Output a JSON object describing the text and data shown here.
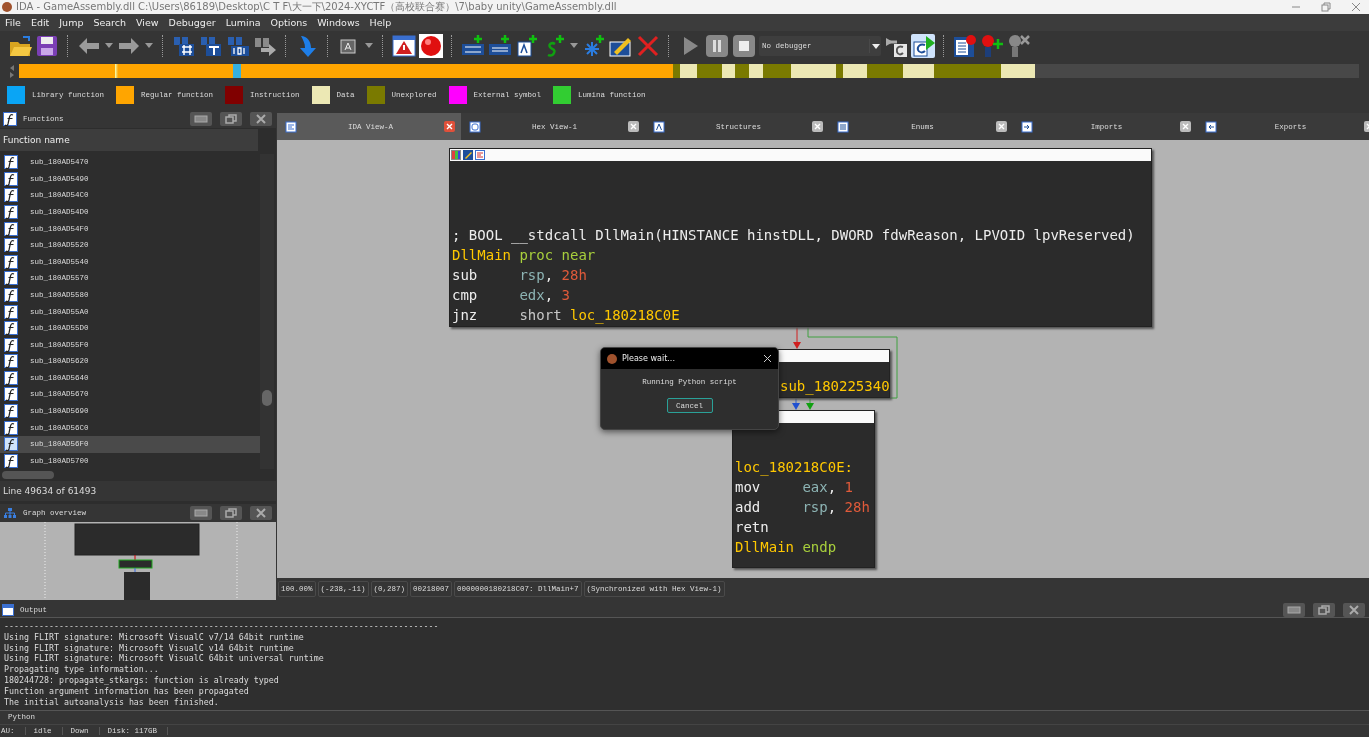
{
  "window": {
    "title": "IDA - GameAssembly.dll C:\\Users\\86189\\Desktop\\C T F\\大一下\\2024-XYCTF（高校联合赛）\\7\\baby unity\\GameAssembly.dll"
  },
  "menu": [
    "File",
    "Edit",
    "Jump",
    "Search",
    "View",
    "Debugger",
    "Lumina",
    "Options",
    "Windows",
    "Help"
  ],
  "toolbar": {
    "debugger": "No debugger"
  },
  "legend": [
    {
      "label": "Library function",
      "color": "#0aa5f5"
    },
    {
      "label": "Regular function",
      "color": "#ffa500"
    },
    {
      "label": "Instruction",
      "color": "#800000"
    },
    {
      "label": "Data",
      "color": "#ece8b4"
    },
    {
      "label": "Unexplored",
      "color": "#7a7a00"
    },
    {
      "label": "External symbol",
      "color": "#ff00ff"
    },
    {
      "label": "Lumina function",
      "color": "#32cd32"
    }
  ],
  "functions": {
    "title": "Functions",
    "column": "Function name",
    "rows": [
      {
        "name": "sub_180AD5470",
        "selected": false
      },
      {
        "name": "sub_180AD5490",
        "selected": false
      },
      {
        "name": "sub_180AD54C0",
        "selected": false
      },
      {
        "name": "sub_180AD54D0",
        "selected": false
      },
      {
        "name": "sub_180AD54F0",
        "selected": false
      },
      {
        "name": "sub_180AD5520",
        "selected": false
      },
      {
        "name": "sub_180AD5540",
        "selected": false
      },
      {
        "name": "sub_180AD5570",
        "selected": false
      },
      {
        "name": "sub_180AD5580",
        "selected": false
      },
      {
        "name": "sub_180AD55A0",
        "selected": false
      },
      {
        "name": "sub_180AD55D0",
        "selected": false
      },
      {
        "name": "sub_180AD55F0",
        "selected": false
      },
      {
        "name": "sub_180AD5620",
        "selected": false
      },
      {
        "name": "sub_180AD5640",
        "selected": false
      },
      {
        "name": "sub_180AD5670",
        "selected": false
      },
      {
        "name": "sub_180AD5690",
        "selected": false
      },
      {
        "name": "sub_180AD56C0",
        "selected": false
      },
      {
        "name": "sub_180AD56F0",
        "selected": true
      },
      {
        "name": "sub_180AD5700",
        "selected": false
      }
    ],
    "line_info": "Line 49634 of 61493"
  },
  "graph_overview": {
    "title": "Graph overview"
  },
  "tabs": [
    {
      "label": "IDA View-A",
      "selected": true
    },
    {
      "label": "Hex View-1",
      "selected": false
    },
    {
      "label": "Structures",
      "selected": false
    },
    {
      "label": "Enums",
      "selected": false
    },
    {
      "label": "Imports",
      "selected": false
    },
    {
      "label": "Exports",
      "selected": false
    }
  ],
  "graph": {
    "nodes": [
      {
        "lines": [
          [
            {
              "text": "; BOOL __stdcall DllMain(HINSTANCE hinstDLL, DWORD fdwReason, LPVOID lpvReserved)",
              "kind": "comment"
            }
          ],
          [
            {
              "text": "DllMain",
              "kind": "label"
            },
            {
              "text": "proc near",
              "kind": "keyword"
            }
          ],
          [
            {
              "text": "sub",
              "kind": "mnemonic"
            },
            {
              "text": "rsp",
              "kind": "register"
            },
            {
              "text": ",",
              "kind": "punct"
            },
            {
              "text": "28h",
              "kind": "number"
            }
          ],
          [
            {
              "text": "cmp",
              "kind": "mnemonic"
            },
            {
              "text": "edx",
              "kind": "register"
            },
            {
              "text": ",",
              "kind": "punct"
            },
            {
              "text": "3",
              "kind": "number"
            }
          ],
          [
            {
              "text": "jnz",
              "kind": "mnemonic"
            },
            {
              "text": "short",
              "kind": "plain"
            },
            {
              "text": "loc_180218C0E",
              "kind": "label"
            }
          ]
        ]
      },
      {
        "lines": [
          [
            {
              "text": "sub_180225340",
              "kind": "label"
            }
          ]
        ]
      },
      {
        "lines": [
          [
            {
              "text": "loc_180218C0E:",
              "kind": "label"
            }
          ],
          [
            {
              "text": "mov",
              "kind": "mnemonic"
            },
            {
              "text": "eax",
              "kind": "register"
            },
            {
              "text": ",",
              "kind": "punct"
            },
            {
              "text": "1",
              "kind": "number"
            }
          ],
          [
            {
              "text": "add",
              "kind": "mnemonic"
            },
            {
              "text": "rsp",
              "kind": "register"
            },
            {
              "text": ",",
              "kind": "punct"
            },
            {
              "text": "28h",
              "kind": "number"
            }
          ],
          [
            {
              "text": "retn",
              "kind": "mnemonic"
            }
          ],
          [
            {
              "text": "DllMain",
              "kind": "label"
            },
            {
              "text": "endp",
              "kind": "keyword"
            }
          ]
        ]
      }
    ]
  },
  "status": [
    "100.00%",
    "(-238,-11)",
    "(0,287)",
    "00218007",
    "0000000180218C07: DllMain+7",
    "(Synchronized with Hex View-1)"
  ],
  "output": {
    "title": "Output",
    "lines": [
      "---------------------------------------------------------------------------------------",
      "Using FLIRT signature: Microsoft VisualC v7/14 64bit runtime",
      "Using FLIRT signature: Microsoft VisualC v14 64bit runtime",
      "Using FLIRT signature: Microsoft VisualC 64bit universal runtime",
      "Propagating type information...",
      "180244728: propagate_stkargs: function is already typed",
      "Function argument information has been propagated",
      "The initial autoanalysis has been finished."
    ]
  },
  "python": {
    "label": "Python"
  },
  "status_bar": [
    "AU:",
    "idle",
    "Down",
    "Disk: 117GB"
  ],
  "dialog": {
    "title": "Please wait...",
    "message": "Running Python script",
    "button": "Cancel"
  }
}
